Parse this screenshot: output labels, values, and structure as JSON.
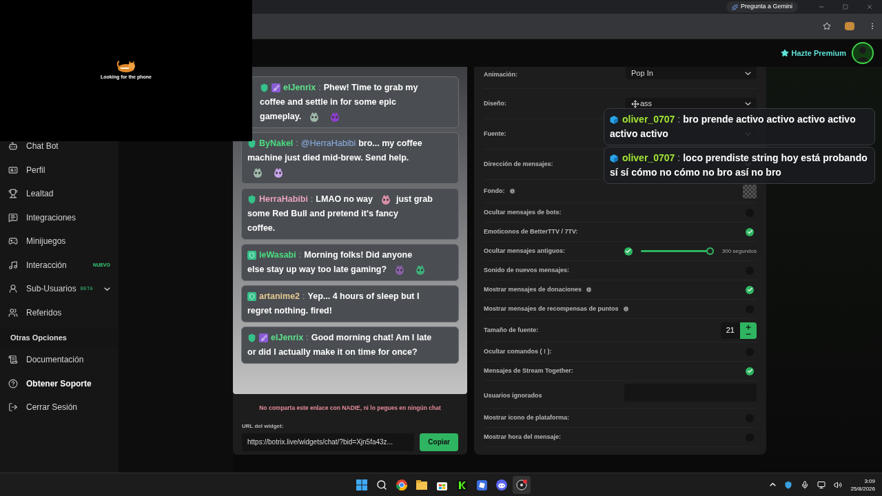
{
  "browser": {
    "gemini_button": "Pregunta a Gemini"
  },
  "header": {
    "premium": "Hazte Premium"
  },
  "video_overlay": {
    "caption": "Looking for the phone"
  },
  "sidebar": {
    "items": [
      {
        "label": "Chat Bot",
        "selected": false
      },
      {
        "label": "Perfil",
        "selected": false
      },
      {
        "label": "Lealtad",
        "selected": false
      },
      {
        "label": "Integraciones",
        "selected": false
      },
      {
        "label": "Minijuegos",
        "selected": false
      },
      {
        "label": "Interacción",
        "selected": false,
        "badge": "NUEVO"
      },
      {
        "label": "Sub-Usuarios",
        "selected": false,
        "badge": "BETA",
        "expanded": false
      },
      {
        "label": "Referidos",
        "selected": false
      }
    ],
    "section": "Otras Opciones",
    "other_items": [
      {
        "label": "Documentación",
        "selected": false
      },
      {
        "label": "Obtener Soporte",
        "selected": true
      },
      {
        "label": "Cerrar Sesión",
        "selected": false
      }
    ]
  },
  "chat_preview": {
    "messages": [
      {
        "user": "elJenrix",
        "color": "#5ee08c",
        "separator": ":",
        "badges": [
          {
            "kind": "shield"
          },
          {
            "kind": "sword"
          }
        ],
        "lines": [
          [
            {
              "kind": "text",
              "text": "Phew! Time to grab my"
            }
          ],
          [
            {
              "kind": "text",
              "text": "coffee and settle in for some epic"
            }
          ],
          [
            {
              "kind": "text",
              "text": "gameplay."
            },
            {
              "kind": "emote",
              "color": "#9fb7a8"
            },
            {
              "kind": "emote",
              "color": "#8b3fc9"
            }
          ]
        ]
      },
      {
        "user": "ByNakel",
        "color": "#4ade80",
        "separator": ":",
        "badges": [
          {
            "kind": "shield"
          }
        ],
        "lines": [
          [
            {
              "kind": "mention",
              "text": "@HerraHabibi"
            },
            {
              "kind": "text",
              "text": "bro... my coffee"
            }
          ],
          [
            {
              "kind": "text",
              "text": "machine just died mid-brew. Send help."
            }
          ],
          [
            {
              "kind": "emote",
              "color": "#9fb7a8"
            },
            {
              "kind": "emote",
              "color": "#c7a3e8"
            }
          ]
        ]
      },
      {
        "user": "HerraHabibi",
        "color": "#e8a3bd",
        "separator": ":",
        "badges": [
          {
            "kind": "shield"
          }
        ],
        "lines": [
          [
            {
              "kind": "text",
              "text": "LMAO no way"
            },
            {
              "kind": "emote",
              "color": "#d88fa8"
            },
            {
              "kind": "text",
              "text": "just grab"
            }
          ],
          [
            {
              "kind": "text",
              "text": "some Red Bull and pretend it's fancy"
            }
          ],
          [
            {
              "kind": "text",
              "text": "coffee."
            }
          ]
        ]
      },
      {
        "user": "leWasabi",
        "color": "#4ade80",
        "separator": ":",
        "badges": [
          {
            "kind": "square"
          }
        ],
        "lines": [
          [
            {
              "kind": "text",
              "text": "Morning folks! Did anyone"
            }
          ],
          [
            {
              "kind": "text",
              "text": "else stay up way too late gaming?"
            },
            {
              "kind": "emote",
              "color": "#8b5fa8"
            },
            {
              "kind": "emote",
              "color": "#3fae7a"
            }
          ]
        ]
      },
      {
        "user": "artanime2",
        "color": "#e3c98f",
        "separator": ":",
        "badges": [
          {
            "kind": "square"
          }
        ],
        "lines": [
          [
            {
              "kind": "text",
              "text": "Yep... 4 hours of sleep but I"
            }
          ],
          [
            {
              "kind": "text",
              "text": "regret nothing. fired!"
            }
          ]
        ]
      },
      {
        "user": "elJenrix",
        "color": "#5ee08c",
        "separator": ":",
        "badges": [
          {
            "kind": "shield"
          },
          {
            "kind": "sword"
          }
        ],
        "lines": [
          [
            {
              "kind": "text",
              "text": "Good morning chat! Am I late"
            }
          ],
          [
            {
              "kind": "text",
              "text": "or did I actually make it on time for once?"
            }
          ]
        ]
      }
    ],
    "warning": "No comparta este enlace con NADIE, ni lo pegues en ningún chat",
    "url_label": "URL del widget:",
    "url_value": "https://botrix.live/widgets/chat/?bid=Xjn5fa43z...",
    "copy_button": "Copiar"
  },
  "settings": [
    {
      "kind": "select",
      "label": "Animación:",
      "value": "Pop In"
    },
    {
      "kind": "select",
      "label": "Diseño:",
      "value": "ass"
    },
    {
      "kind": "select",
      "label": "Fuente:"
    },
    {
      "kind": "select",
      "label": "Dirección de mensajes:"
    },
    {
      "kind": "swatch",
      "label": "Fondo:",
      "info": true
    },
    {
      "kind": "checkbox",
      "label": "Ocultar mensajes de bots:",
      "checked": false
    },
    {
      "kind": "checkbox",
      "label": "Emoticonos de BetterTTV / 7TV:",
      "checked": true
    },
    {
      "kind": "timed",
      "label": "Ocultar mensajes antiguos:",
      "checked": true,
      "level": 1,
      "reading": "300 segundos"
    },
    {
      "kind": "checkbox",
      "label": "Sonido de nuevos mensajes:",
      "checked": false
    },
    {
      "kind": "checkbox",
      "label": "Mostrar mensajes de donaciones",
      "info": true,
      "checked": true
    },
    {
      "kind": "checkbox",
      "label": "Mostrar mensajes de recompensas de puntos",
      "info": true,
      "checked": false
    },
    {
      "kind": "number",
      "label": "Tamaño de fuente:",
      "value": "21"
    },
    {
      "kind": "checkbox",
      "label": "Ocultar comandos ( ! ):",
      "checked": false
    },
    {
      "kind": "checkbox",
      "label": "Mensajes de Stream Together:",
      "checked": true
    },
    {
      "kind": "textarea",
      "label": "Usuarios ignorados"
    },
    {
      "kind": "checkbox",
      "label": "Mostrar icono de plataforma:",
      "checked": false
    },
    {
      "kind": "checkbox",
      "label": "Mostrar hora del mensaje:",
      "checked": false
    }
  ],
  "overlay_messages": [
    {
      "user": "oliver_0707",
      "color": "#a3e635",
      "separator": ":",
      "lines": [
        "bro prende activo activo activo activo",
        "activo activo"
      ]
    },
    {
      "user": "oliver_0707",
      "color": "#a3e635",
      "separator": ":",
      "lines": [
        "loco prendiste string hoy está probando",
        "sí sí cómo no cómo no bro así no bro"
      ]
    }
  ],
  "taskbar": {
    "time": "3:09",
    "date": "25/8/2026"
  }
}
